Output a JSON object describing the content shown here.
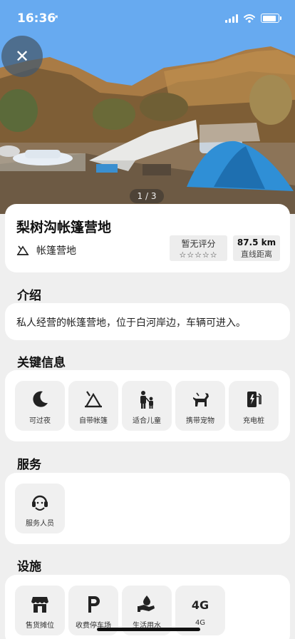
{
  "status_bar": {
    "time": "16:36",
    "location_glyph": "➚",
    "battery_level": 0.9
  },
  "gallery": {
    "pager": "1 / 3",
    "close_glyph": "✕"
  },
  "place": {
    "name": "梨树沟帐篷营地",
    "type": "帐篷营地",
    "rating_text": "暂无评分",
    "stars": "☆☆☆☆☆",
    "distance_value": "87.5 km",
    "distance_label": "直线距离"
  },
  "intro": {
    "title": "介绍",
    "text": "私人经营的帐篷营地，位于白河岸边，车辆可进入。"
  },
  "key_info": {
    "title": "关键信息",
    "items": [
      {
        "label": "可过夜",
        "icon": "moon-icon"
      },
      {
        "label": "自带帐篷",
        "icon": "tent-icon"
      },
      {
        "label": "适合儿童",
        "icon": "family-icon"
      },
      {
        "label": "携带宠物",
        "icon": "dog-icon"
      },
      {
        "label": "充电桩",
        "icon": "ev-charger-icon"
      }
    ]
  },
  "services": {
    "title": "服务",
    "items": [
      {
        "label": "服务人员",
        "icon": "staff-icon"
      }
    ]
  },
  "facilities": {
    "title": "设施",
    "items": [
      {
        "label": "售货摊位",
        "icon": "stall-icon"
      },
      {
        "label": "收费停车场",
        "icon": "parking-icon"
      },
      {
        "label": "生活用水",
        "icon": "water-icon"
      },
      {
        "label": "4G",
        "icon": "4g-icon"
      }
    ]
  },
  "colors": {
    "background": "#efefef",
    "card": "#ffffff",
    "tile": "#f0f0f0",
    "tent_blue": "#2f8fd6"
  }
}
